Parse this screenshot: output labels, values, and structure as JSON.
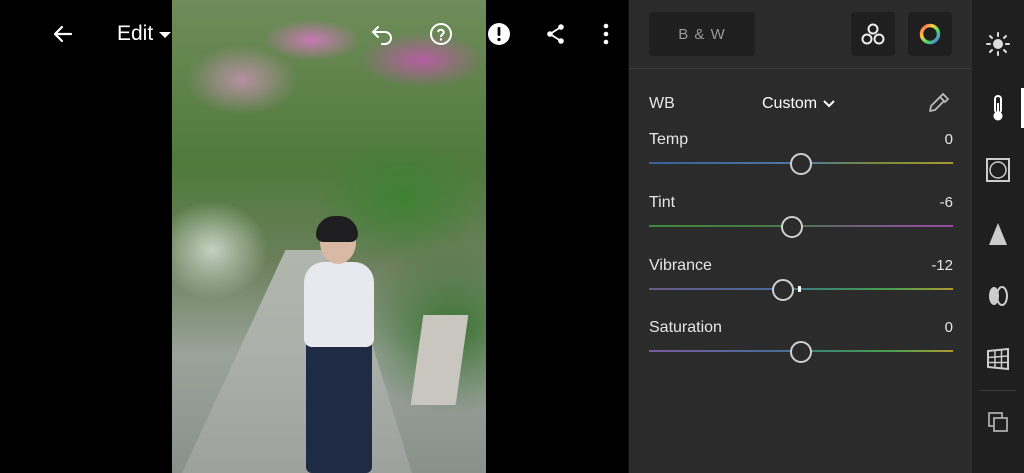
{
  "header": {
    "back_icon": "arrow-left-icon",
    "mode_label": "Edit",
    "actions": [
      "undo-icon",
      "help-icon",
      "alert-icon",
      "share-icon",
      "more-vertical-icon"
    ]
  },
  "panel": {
    "bw_label": "B & W",
    "profiles_icon": "profiles-icon",
    "color_mix_icon": "color-wheel-icon",
    "wb": {
      "label": "WB",
      "value": "Custom"
    },
    "sliders": [
      {
        "id": "temp",
        "label": "Temp",
        "value": "0",
        "position": 0.5
      },
      {
        "id": "tint",
        "label": "Tint",
        "value": "-6",
        "position": 0.47
      },
      {
        "id": "vibrance",
        "label": "Vibrance",
        "value": "-12",
        "position": 0.44
      },
      {
        "id": "saturation",
        "label": "Saturation",
        "value": "0",
        "position": 0.5
      }
    ]
  },
  "sidebar": {
    "items": [
      "light-icon",
      "color-thermometer-icon",
      "effects-vignette-icon",
      "detail-sharpen-icon",
      "optics-lens-icon",
      "geometry-icon",
      "presets-versions-icon"
    ],
    "active": "color-thermometer-icon"
  },
  "colors": {
    "panel_bg": "#2b2b2b",
    "sidebar_bg": "#1f1f1f",
    "accent": "#ffffff"
  }
}
